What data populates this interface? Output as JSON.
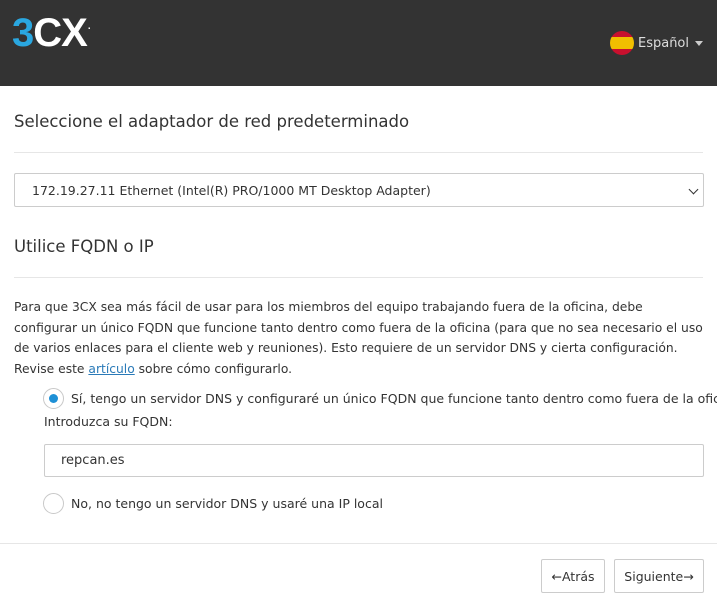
{
  "header": {
    "logo_text": "3CX",
    "language": {
      "label": "Español",
      "flag_icon": "spain-flag-icon"
    }
  },
  "colors": {
    "topbar": "#333333",
    "accent": "#2aa7e0",
    "link": "#2a7ab8",
    "radio_selected": "#1e90d6"
  },
  "adapter_section": {
    "title": "Seleccione el adaptador de red predeterminado",
    "selected_adapter": "172.19.27.11 Ethernet (Intel(R) PRO/1000 MT Desktop Adapter)"
  },
  "fqdn_section": {
    "title": "Utilice FQDN o IP",
    "paragraph_before_link": "Para que 3CX sea más fácil de usar para los miembros del equipo trabajando fuera de la oficina, debe configurar un único FQDN que funcione tanto dentro como fuera de la oficina (para que no sea necesario el uso de varios enlaces para el cliente web y reuniones). Esto requiere de un servidor DNS y cierta configuración. Revise este ",
    "link_text": "artículo",
    "paragraph_after_link": " sobre cómo configurarlo.",
    "options": [
      {
        "label": "Sí, tengo un servidor DNS y configuraré un único FQDN que funcione tanto dentro como fuera de la oficina",
        "selected": true
      },
      {
        "label": "No, no tengo un servidor DNS y usaré una IP local",
        "selected": false
      }
    ],
    "fqdn_label": "Introduzca su FQDN:",
    "fqdn_value": "repcan.es"
  },
  "footer": {
    "back_label": "←Atrás",
    "next_label": "Siguiente→"
  }
}
